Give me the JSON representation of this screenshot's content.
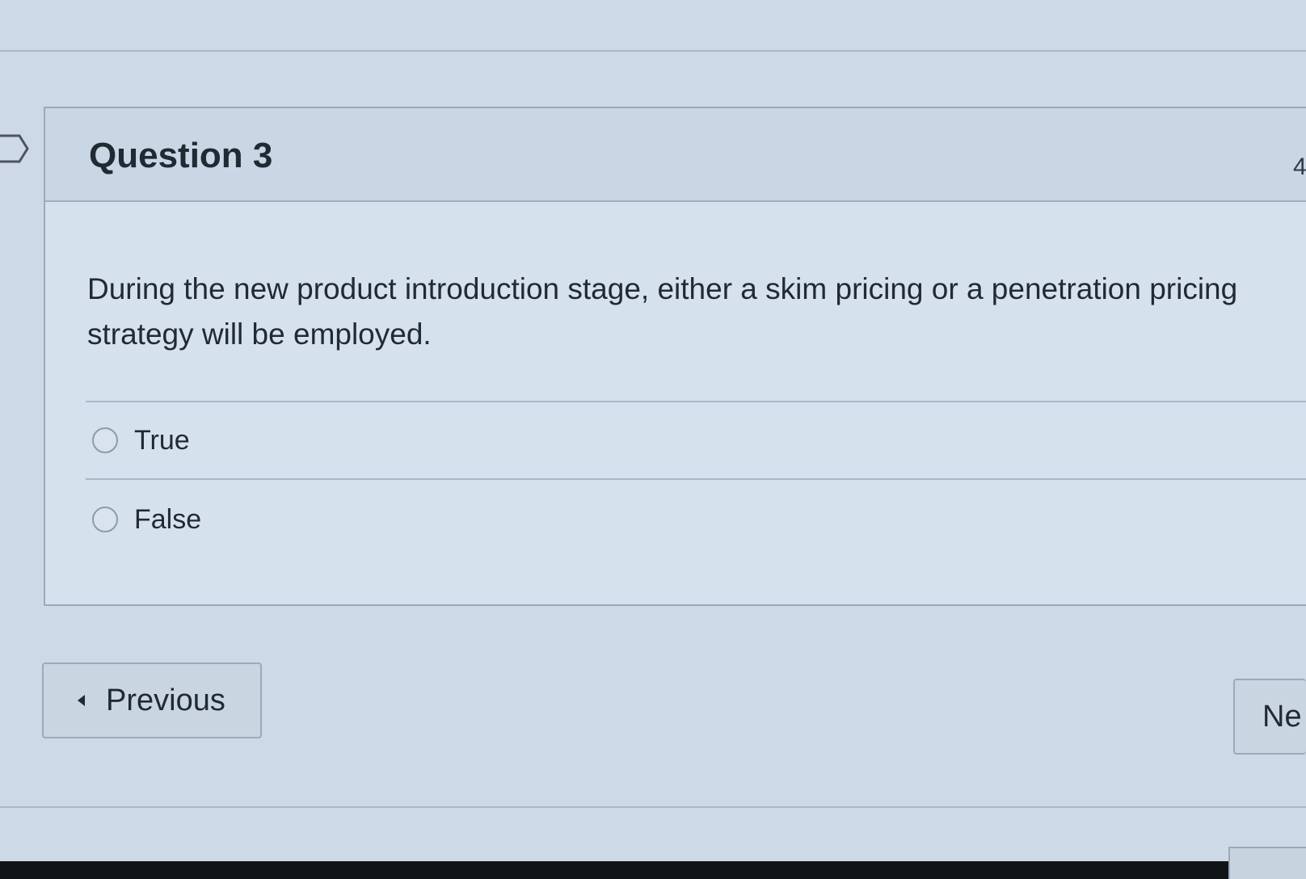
{
  "question": {
    "title": "Question 3",
    "points_partial": "4",
    "text": "During the new product introduction stage, either a skim pricing or a penetration pricing strategy will be employed.",
    "text_line1": "During the new product introduction stage, either a skim pricing or a penetration pricing",
    "text_line2": "strategy will be employed."
  },
  "answers": [
    {
      "label": "True",
      "selected": false
    },
    {
      "label": "False",
      "selected": false
    }
  ],
  "navigation": {
    "previous_label": "Previous",
    "next_label_partial": "Ne"
  },
  "icons": {
    "flag": "flag-question-icon",
    "previous": "caret-left-icon"
  },
  "colors": {
    "page_background": "#cdd9e6",
    "header_background": "#c9d6e3",
    "text": "#1f2a33"
  }
}
